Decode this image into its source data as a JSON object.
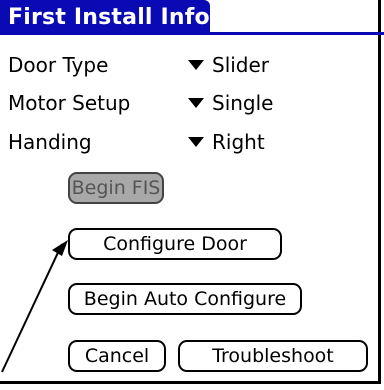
{
  "window": {
    "title": "First Install Info",
    "accent_color": "#0a0ab4"
  },
  "fields": [
    {
      "label": "Door Type",
      "value": "Slider"
    },
    {
      "label": "Motor Setup",
      "value": "Single"
    },
    {
      "label": "Handing",
      "value": "Right"
    }
  ],
  "buttons": {
    "begin_fis": "Begin FIS",
    "configure_door": "Configure Door",
    "begin_auto_configure": "Begin Auto Configure",
    "cancel": "Cancel",
    "troubleshoot": "Troubleshoot"
  },
  "icons": {
    "picker_arrow": "triangle-down"
  }
}
